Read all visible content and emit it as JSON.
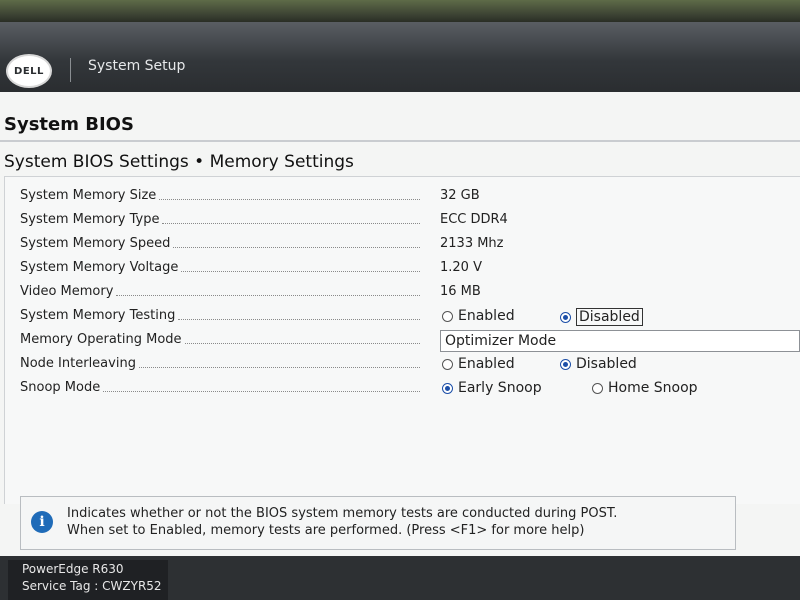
{
  "header": {
    "logo_text": "DELL",
    "title": "System Setup"
  },
  "page_title": "System BIOS",
  "subtitle": "System BIOS Settings • Memory Settings",
  "settings": {
    "memory_size": {
      "label": "System Memory Size",
      "value": "32 GB"
    },
    "memory_type": {
      "label": "System Memory Type",
      "value": "ECC DDR4"
    },
    "memory_speed": {
      "label": "System Memory Speed",
      "value": "2133 Mhz"
    },
    "memory_voltage": {
      "label": "System Memory Voltage",
      "value": "1.20 V"
    },
    "video_memory": {
      "label": "Video Memory",
      "value": "16 MB"
    },
    "memory_testing": {
      "label": "System Memory Testing",
      "option_enabled": "Enabled",
      "option_disabled": "Disabled",
      "selected": "Disabled"
    },
    "operating_mode": {
      "label": "Memory Operating Mode",
      "value": "Optimizer Mode"
    },
    "node_interleaving": {
      "label": "Node Interleaving",
      "option_enabled": "Enabled",
      "option_disabled": "Disabled",
      "selected": "Disabled"
    },
    "snoop_mode": {
      "label": "Snoop Mode",
      "option_early": "Early Snoop",
      "option_home": "Home Snoop",
      "selected": "Early Snoop"
    }
  },
  "help": {
    "icon": "info-icon",
    "line1": "Indicates whether or not the BIOS system memory tests are conducted during POST.",
    "line2": "When set to Enabled, memory tests are performed. (Press <F1> for more help)"
  },
  "footer": {
    "model": "PowerEdge R630",
    "service_tag": "Service Tag : CWZYR52"
  },
  "colors": {
    "header_bg": "#33373b",
    "radio_selected": "#1c4fa8",
    "info_icon": "#1f6bb8"
  }
}
